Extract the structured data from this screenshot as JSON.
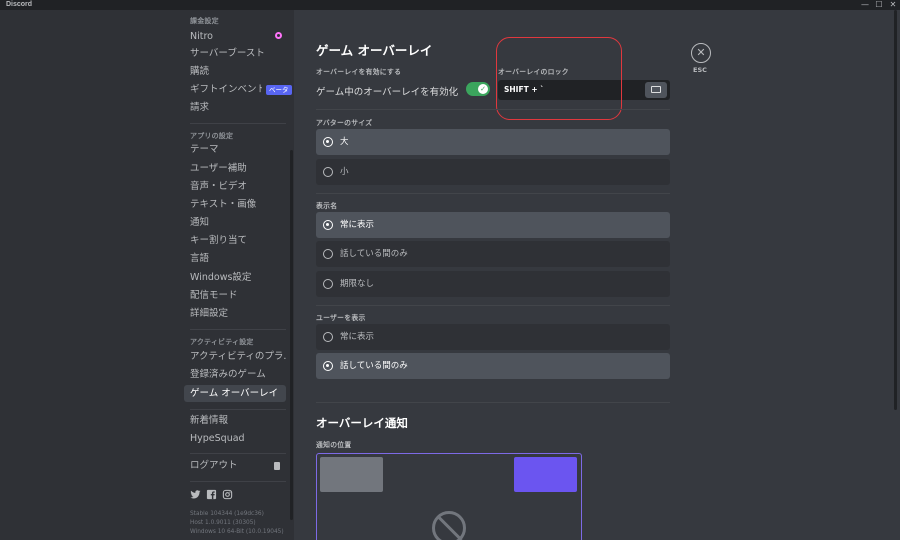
{
  "window": {
    "app_name": "Discord",
    "controls": [
      "—",
      "☐",
      "✕"
    ]
  },
  "sidebar": {
    "billing_header": "課金設定",
    "billing_items": [
      "Nitro",
      "サーバーブースト",
      "購読",
      "ギフトインベントリ",
      "請求"
    ],
    "beta_badge": "ベータ",
    "app_header": "アプリの設定",
    "app_items": [
      "テーマ",
      "ユーザー補助",
      "音声・ビデオ",
      "テキスト・画像",
      "通知",
      "キー割り当て",
      "言語",
      "Windows設定",
      "配信モード",
      "詳細設定"
    ],
    "activity_header": "アクティビティ設定",
    "activity_items": [
      "アクティビティのプラ...",
      "登録済みのゲーム",
      "ゲーム オーバーレイ"
    ],
    "misc_items": [
      "新着情報",
      "HypeSquad"
    ],
    "logout": "ログアウト",
    "version_lines": [
      "Stable 104344 (1e9dc36)",
      "Host 1.0.9011 (30305)",
      "Windows 10 64-Bit (10.0.19045)"
    ]
  },
  "content": {
    "title": "ゲーム オーバーレイ",
    "enable_label": "オーバーレイを有効にする",
    "enable_text": "ゲーム中のオーバーレイを有効化",
    "toggle_on": true,
    "lock_label": "オーバーレイのロック",
    "lock_key": "SHIFT + `",
    "esc": "ESC",
    "avatar_size_label": "アバターのサイズ",
    "avatar_size_options": [
      "大",
      "小"
    ],
    "display_name_label": "表示名",
    "display_name_options": [
      "常に表示",
      "話している間のみ",
      "期限なし"
    ],
    "show_users_label": "ユーザーを表示",
    "show_users_options": [
      "常に表示",
      "話している間のみ"
    ],
    "notif_title": "オーバーレイ通知",
    "notif_pos_label": "通知の位置"
  },
  "colors": {
    "accent": "#5865f2",
    "toggle_green": "#3ba55d",
    "highlight_red": "#e0383e",
    "notif_selected": "#6b55f0"
  }
}
